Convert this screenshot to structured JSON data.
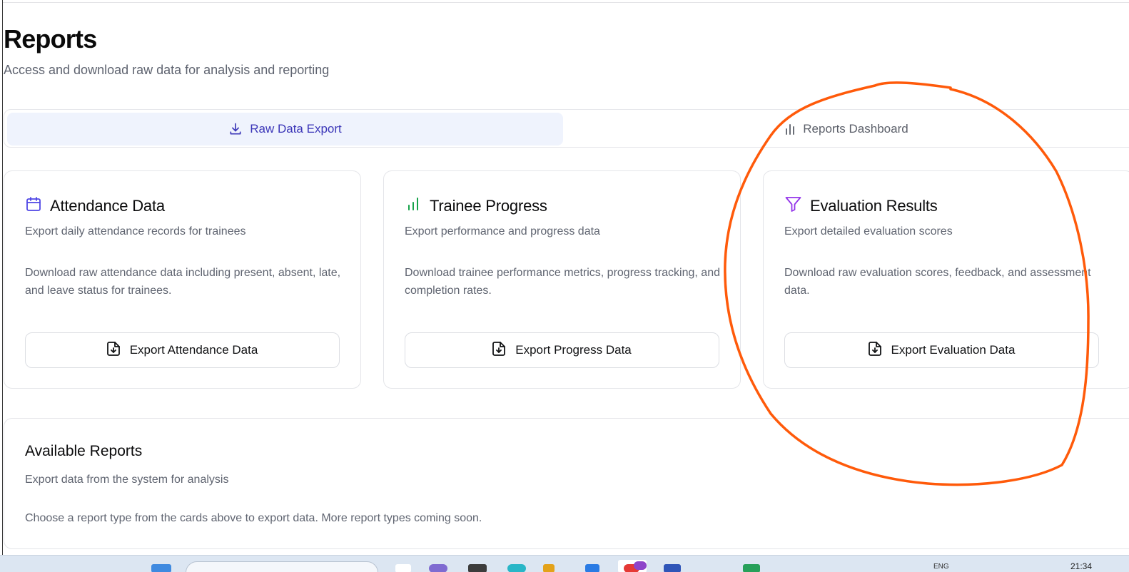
{
  "header": {
    "title": "Reports",
    "subtitle": "Access and download raw data for analysis and reporting"
  },
  "tabs": [
    {
      "label": "Raw Data Export",
      "icon": "download-icon",
      "active": true
    },
    {
      "label": "Reports Dashboard",
      "icon": "bar-chart-icon",
      "active": false
    }
  ],
  "cards": [
    {
      "title": "Attendance Data",
      "icon": "calendar-icon",
      "icon_color": "#4f46e5",
      "description": "Export daily attendance records for trainees",
      "body": "Download raw attendance data including present, absent, late, and leave status for trainees.",
      "button_label": "Export Attendance Data"
    },
    {
      "title": "Trainee Progress",
      "icon": "bar-chart-icon",
      "icon_color": "#16a34a",
      "description": "Export performance and progress data",
      "body": "Download trainee performance metrics, progress tracking, and completion rates.",
      "button_label": "Export Progress Data"
    },
    {
      "title": "Evaluation Results",
      "icon": "filter-icon",
      "icon_color": "#9333ea",
      "description": "Export detailed evaluation scores",
      "body": "Download raw evaluation scores, feedback, and assessment data.",
      "button_label": "Export Evaluation Data"
    }
  ],
  "available_reports": {
    "title": "Available Reports",
    "subtitle": "Export data from the system for analysis",
    "message": "Choose a report type from the cards above to export data. More report types coming soon."
  },
  "taskbar": {
    "language": "ENG",
    "clock": "21:34"
  },
  "colors": {
    "active_tab_bg": "#eff3fd",
    "active_tab_text": "#3b36b8",
    "annotation": "#ff5a0a"
  }
}
